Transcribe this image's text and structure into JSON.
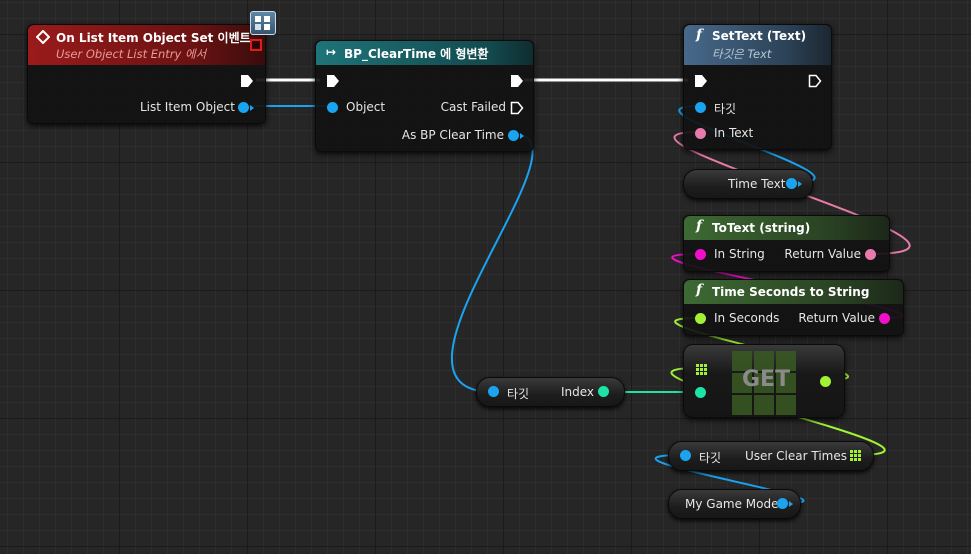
{
  "colors": {
    "event_header": "#8b1a1a",
    "cast_header": "#1d6e73",
    "settext_header": "#3c5a74",
    "pure_header": "#2f4d22",
    "pin_object": "#1aa3ef",
    "pin_text": "#e87bab",
    "pin_string": "#f20fc9",
    "pin_float": "#a1f234",
    "pin_int": "#1ee3a6"
  },
  "event_node": {
    "title": "On List Item Object Set 이벤트",
    "subtitle": "User Object List Entry 에서",
    "output_label": "List Item Object"
  },
  "cast_node": {
    "title": "BP_ClearTime 에 형변환",
    "object_label": "Object",
    "cast_failed_label": "Cast Failed",
    "as_label": "As BP Clear Time"
  },
  "settext_node": {
    "icon": "function-icon",
    "title": "SetText (Text)",
    "subtitle": "타깃은 Text",
    "target_label": "타깃",
    "intext_label": "In Text"
  },
  "timetext_var": {
    "label": "Time Text"
  },
  "totext_node": {
    "icon": "function-icon",
    "title": "ToText (string)",
    "input_label": "In String",
    "output_label": "Return Value"
  },
  "timesec_node": {
    "icon": "function-icon",
    "title": "Time Seconds to String",
    "input_label": "In Seconds",
    "output_label": "Return Value"
  },
  "index_var": {
    "target_label": "타깃",
    "label": "Index"
  },
  "get_node": {
    "label": "GET"
  },
  "clear_times_var": {
    "target_label": "타깃",
    "label": "User Clear Times"
  },
  "game_mode_var": {
    "label": "My Game Mode"
  }
}
